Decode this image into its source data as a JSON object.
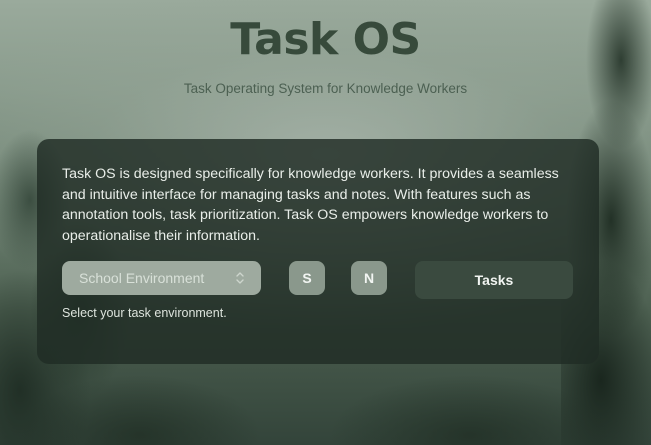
{
  "header": {
    "title": "Task OS",
    "subtitle": "Task Operating System for Knowledge Workers"
  },
  "panel": {
    "description": "Task OS is designed specifically for knowledge workers. It provides a seamless and intuitive interface for managing tasks and notes. With features such as annotation tools, task prioritization. Task OS empowers knowledge workers to operationalise their information.",
    "environment_select": {
      "value": "School Environment",
      "icon": "chevron-up-down-icon"
    },
    "helper_text": "Select your task environment.",
    "buttons": {
      "s_label": "S",
      "n_label": "N",
      "tasks_label": "Tasks"
    }
  },
  "colors": {
    "title": "#374a3b",
    "panel_bg": "#202c24",
    "select_bg": "#9eaa9f",
    "square_button_bg": "#8a988c",
    "tasks_button_bg": "#3a4a3f"
  }
}
